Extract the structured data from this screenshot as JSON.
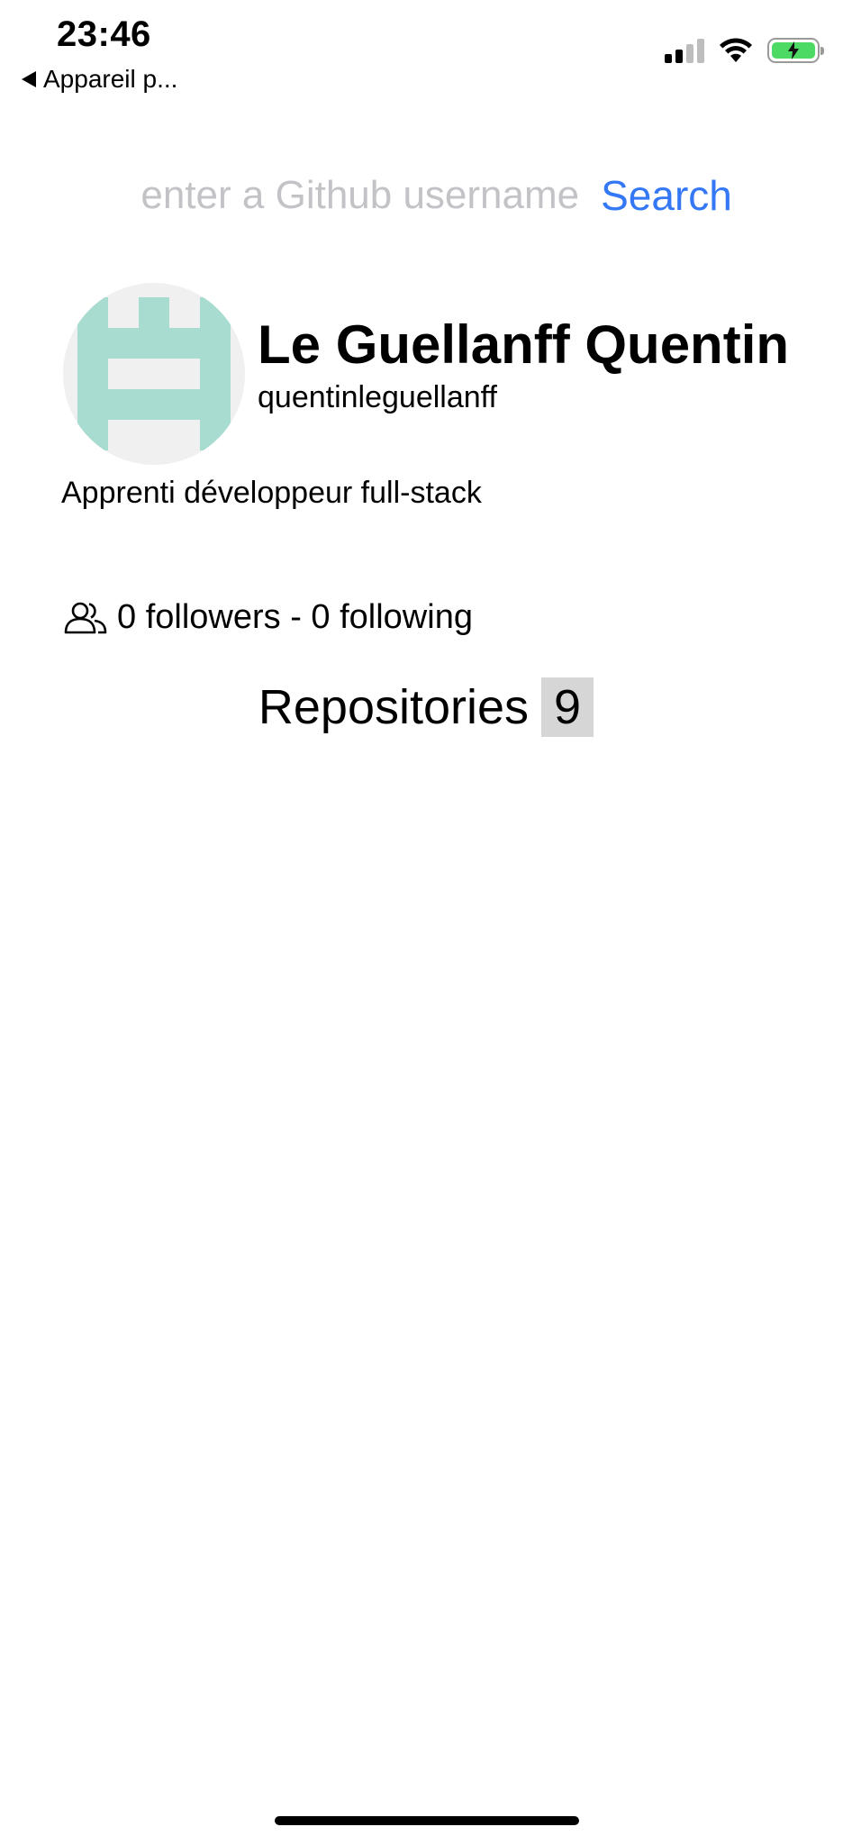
{
  "status_bar": {
    "time": "23:46",
    "back_label": "Appareil p...",
    "battery_color": "#4cd964",
    "signal_bars_active": 2
  },
  "search": {
    "placeholder": "enter a Github username",
    "value": "",
    "button_label": "Search",
    "button_color": "#3478f6"
  },
  "profile": {
    "name": "Le Guellanff Quentin",
    "login": "quentinleguellanff",
    "bio": "Apprenti développeur full-stack",
    "avatar_color": "#a8dcd1"
  },
  "followers": {
    "icon": "people-icon",
    "text": "0 followers - 0 following"
  },
  "repositories": {
    "label": "Repositories",
    "count": "9"
  }
}
